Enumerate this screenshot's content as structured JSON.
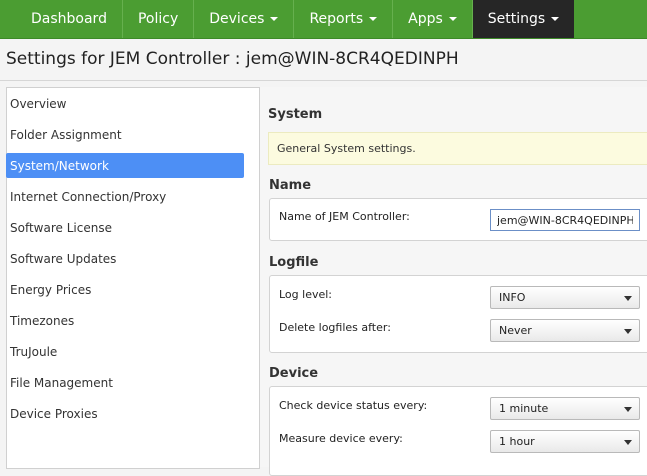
{
  "nav": {
    "items": [
      {
        "label": "Dashboard",
        "dropdown": false
      },
      {
        "label": "Policy",
        "dropdown": false
      },
      {
        "label": "Devices",
        "dropdown": true
      },
      {
        "label": "Reports",
        "dropdown": true
      },
      {
        "label": "Apps",
        "dropdown": true
      },
      {
        "label": "Settings",
        "dropdown": true,
        "active": true
      }
    ]
  },
  "page": {
    "title": "Settings for JEM Controller : jem@WIN-8CR4QEDINPH"
  },
  "sidebar": {
    "items": [
      {
        "label": "Overview"
      },
      {
        "label": "Folder Assignment"
      },
      {
        "label": "System/Network",
        "selected": true
      },
      {
        "label": "Internet Connection/Proxy"
      },
      {
        "label": "Software License"
      },
      {
        "label": "Software Updates"
      },
      {
        "label": "Energy Prices"
      },
      {
        "label": "Timezones"
      },
      {
        "label": "TruJoule"
      },
      {
        "label": "File Management"
      },
      {
        "label": "Device Proxies"
      }
    ]
  },
  "main": {
    "heading": "System",
    "banner": "General System settings.",
    "name_section": {
      "title": "Name",
      "controller_name_label": "Name of JEM Controller:",
      "controller_name_value": "jem@WIN-8CR4QEDINPH"
    },
    "logfile_section": {
      "title": "Logfile",
      "log_level_label": "Log level:",
      "log_level_value": "INFO",
      "delete_after_label": "Delete logfiles after:",
      "delete_after_value": "Never"
    },
    "device_section": {
      "title": "Device",
      "check_status_label": "Check device status every:",
      "check_status_value": "1 minute",
      "measure_label": "Measure device every:",
      "measure_value": "1 hour"
    }
  },
  "colors": {
    "nav_bg": "#4b9d32",
    "nav_active_bg": "#262626",
    "selection": "#4d8ff5",
    "banner_bg": "#fcfbdf"
  }
}
